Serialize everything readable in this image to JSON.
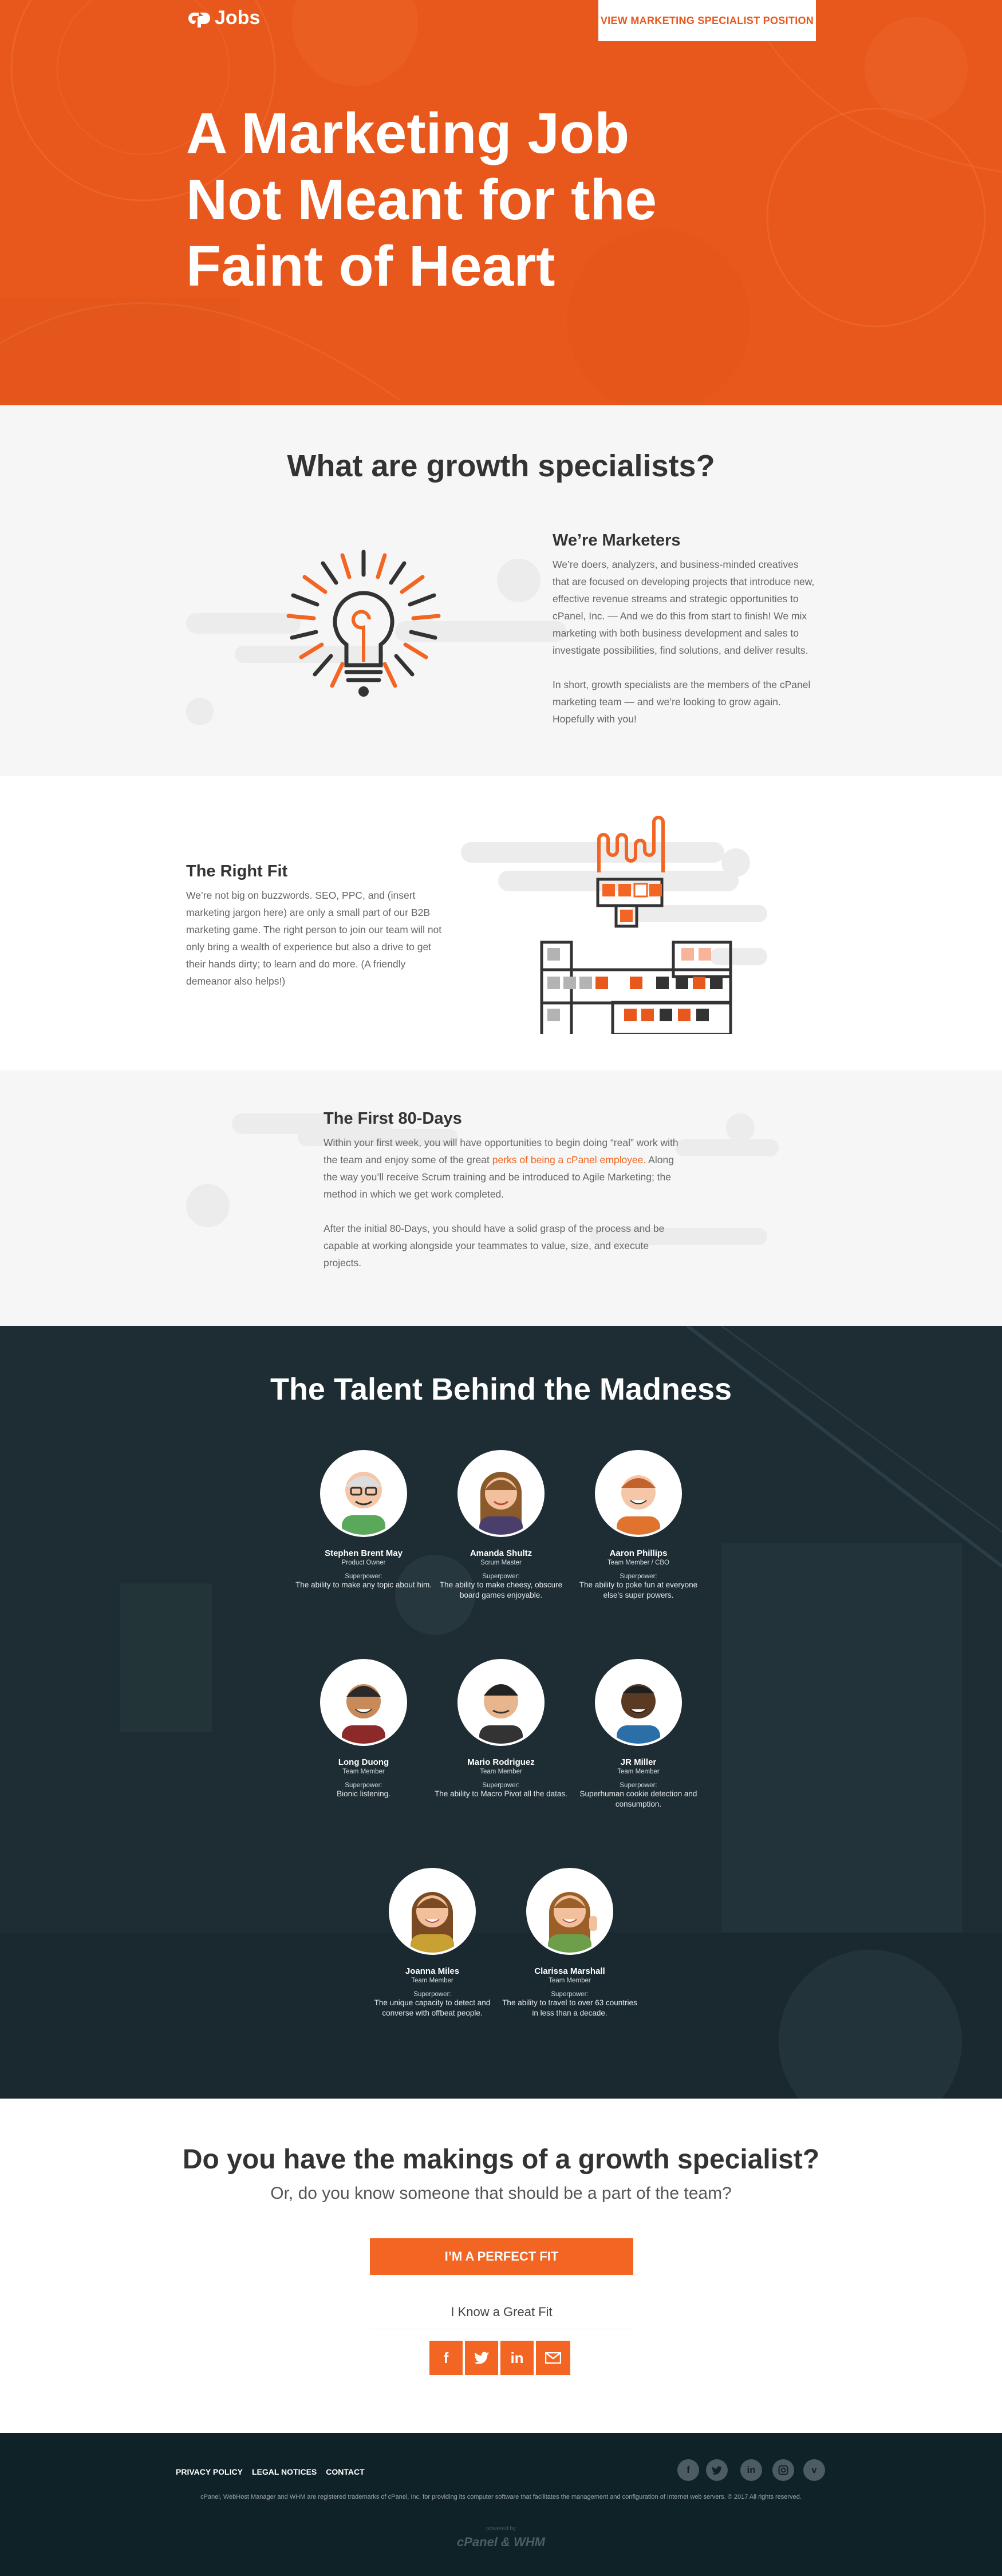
{
  "header": {
    "logo_text": "Jobs",
    "cta_label": "VIEW MARKETING SPECIALIST POSITION"
  },
  "hero": {
    "title_lines": [
      "A Marketing Job",
      "Not Meant for the",
      "Faint of Heart"
    ]
  },
  "growth": {
    "heading": "What are growth specialists?",
    "subheading": "We’re Marketers",
    "para1": "We’re doers, analyzers, and business-minded creatives that are focused on developing projects that introduce new, effective revenue streams and strategic opportunities to cPanel, Inc.  — And we do this from start to finish! We mix marketing with both business development and sales to investigate possibilities, find solutions, and deliver results.",
    "para2": "In short, growth specialists are the members of the cPanel marketing team — and we’re looking to grow again. Hopefully with you!"
  },
  "fit": {
    "heading": "The Right Fit",
    "para": "We’re not big on buzzwords. SEO, PPC, and (insert marketing jargon here) are only a small part of our B2B marketing game. The right person to join our team will not only bring a wealth of experience but also a drive to get their hands dirty; to learn and do more. (A friendly demeanor also helps!)"
  },
  "first80": {
    "heading": "The First 80-Days",
    "para1_a": "Within your first week, you will have opportunities to begin doing “real” work with the team and enjoy some of the great ",
    "para1_link": "perks of being a cPanel employee.",
    "para1_b": " Along the way you’ll receive Scrum training and be introduced to Agile Marketing; the method in which we get work completed.",
    "para2": "After the initial 80-Days, you should have a solid grasp of the process and be capable at working alongside your teammates to value, size, and execute projects."
  },
  "talent": {
    "heading": "The Talent Behind the Madness",
    "superpower_label": "Superpower:",
    "members": [
      {
        "name": "Stephen Brent May",
        "role": "Product Owner",
        "superpower": "The ability to make any topic about him."
      },
      {
        "name": "Amanda Shultz",
        "role": "Scrum Master",
        "superpower": "The ability to make cheesy, obscure board games enjoyable."
      },
      {
        "name": "Aaron Phillips",
        "role": "Team Member / CBO",
        "superpower": "The ability to poke fun at everyone else’s super powers."
      },
      {
        "name": "Long Duong",
        "role": "Team Member",
        "superpower": "Bionic listening."
      },
      {
        "name": "Mario Rodriguez",
        "role": "Team Member",
        "superpower": "The ability to Macro Pivot all the datas."
      },
      {
        "name": "JR Miller",
        "role": "Team Member",
        "superpower": "Superhuman cookie detection and consumption."
      },
      {
        "name": "Joanna Miles",
        "role": "Team Member",
        "superpower": "The unique capacity to detect and converse with offbeat people."
      },
      {
        "name": "Clarissa Marshall",
        "role": "Team Member",
        "superpower": "The ability to travel to over 63 countries in less than a decade."
      }
    ]
  },
  "cta": {
    "heading": "Do you have the makings of a growth specialist?",
    "subheading": "Or, do you know someone that should be a part of the team?",
    "button": "I’M A PERFECT FIT",
    "know_label": "I Know a Great Fit",
    "share_icons": [
      "facebook-icon",
      "twitter-icon",
      "linkedin-icon",
      "email-icon"
    ]
  },
  "footer": {
    "links": [
      "PRIVACY POLICY",
      "LEGAL NOTICES",
      "CONTACT"
    ],
    "social_icons": [
      "facebook-icon",
      "twitter-icon",
      "linkedin-icon",
      "instagram-icon",
      "vimeo-icon"
    ],
    "legal": "cPanel, WebHost Manager and WHM are registered trademarks of cPanel, Inc. for providing its computer software that facilitates the management and configuration of Internet web servers. © 2017 All rights reserved.",
    "powered_label": "powered by",
    "powered_logo": "cPanel & WHM"
  },
  "colors": {
    "brand_orange": "#f26522",
    "hero_orange": "#e8581d",
    "dark_teal": "#1d2d33",
    "footer_dark": "#0f2228"
  }
}
